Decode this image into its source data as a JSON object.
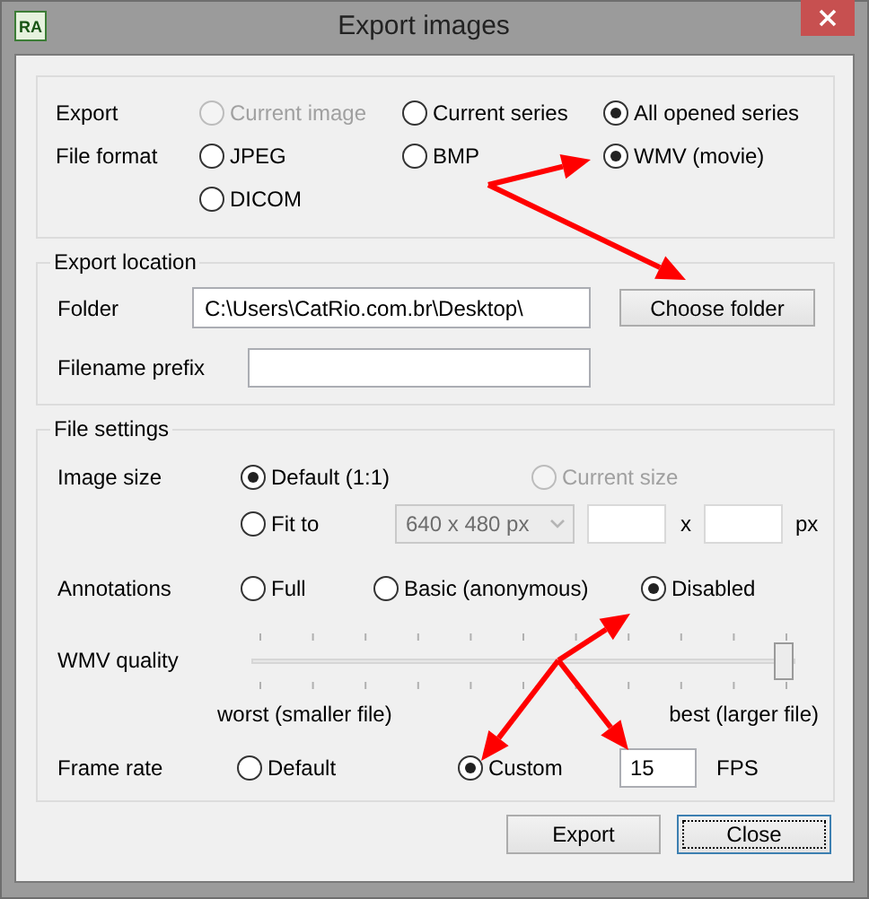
{
  "window": {
    "title": "Export images",
    "app_logo": "RA"
  },
  "export_group": {
    "rows": [
      {
        "label": "Export",
        "options": [
          {
            "label": "Current image",
            "selected": false,
            "disabled": true
          },
          {
            "label": "Current series",
            "selected": false,
            "disabled": false
          },
          {
            "label": "All opened series",
            "selected": true,
            "disabled": false
          }
        ]
      },
      {
        "label": "File format",
        "options": [
          {
            "label": "JPEG",
            "selected": false,
            "disabled": false
          },
          {
            "label": "BMP",
            "selected": false,
            "disabled": false
          },
          {
            "label": "WMV (movie)",
            "selected": true,
            "disabled": false
          },
          {
            "label": "DICOM",
            "selected": false,
            "disabled": false
          }
        ]
      }
    ]
  },
  "export_location": {
    "title": "Export location",
    "folder": {
      "label": "Folder",
      "value": "C:\\Users\\CatRio.com.br\\Desktop\\"
    },
    "choose_button": "Choose folder",
    "prefix": {
      "label": "Filename prefix"
    }
  },
  "file_settings": {
    "title": "File settings",
    "image_size": {
      "label": "Image size",
      "options": [
        {
          "label": "Default (1:1)",
          "selected": true,
          "disabled": false
        },
        {
          "label": "Current size",
          "selected": false,
          "disabled": true
        },
        {
          "label": "Fit to",
          "selected": false,
          "disabled": false
        }
      ],
      "size_dropdown": {
        "value": "640 x 480 px",
        "disabled": true
      },
      "times_label": "x",
      "unit_label": "px"
    },
    "annotations": {
      "label": "Annotations",
      "options": [
        {
          "label": "Full",
          "selected": false,
          "disabled": false
        },
        {
          "label": "Basic (anonymous)",
          "selected": false,
          "disabled": false
        },
        {
          "label": "Disabled",
          "selected": true,
          "disabled": false
        }
      ]
    },
    "quality": {
      "label": "WMV quality",
      "level": 1,
      "min_label": "worst (smaller file)",
      "max_label": "best (larger file)"
    },
    "frame_rate": {
      "label": "Frame rate",
      "options": [
        {
          "label": "Default",
          "selected": false,
          "disabled": false
        },
        {
          "label": "Custom",
          "selected": true,
          "disabled": false
        }
      ],
      "fps_value": "15",
      "fps_unit": "FPS"
    }
  },
  "buttons": [
    {
      "label": "Export",
      "focused": false
    },
    {
      "label": "Close",
      "focused": true
    }
  ]
}
